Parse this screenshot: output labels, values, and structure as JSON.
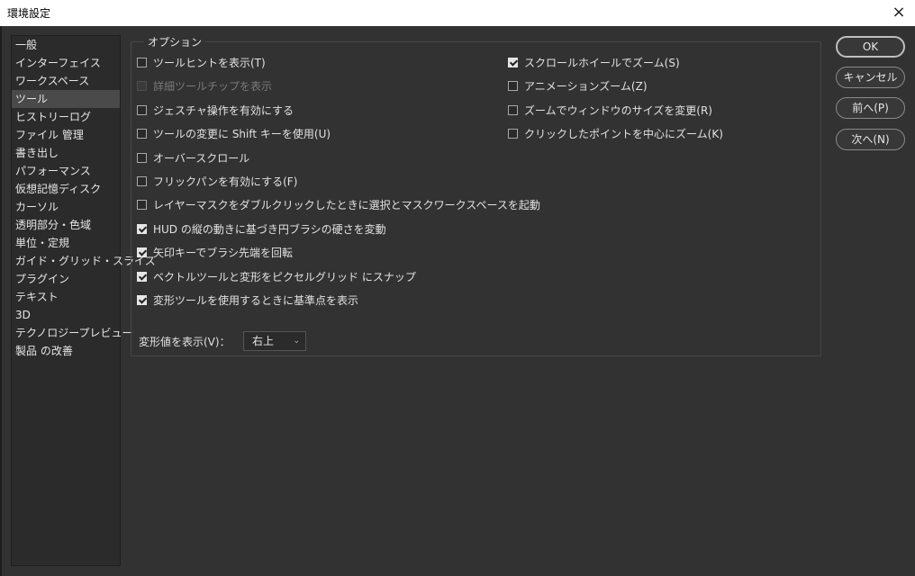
{
  "window": {
    "title": "環境設定",
    "close_icon": "×"
  },
  "sidebar": {
    "items": [
      {
        "label": "一般"
      },
      {
        "label": "インターフェイス"
      },
      {
        "label": "ワークスペース"
      },
      {
        "label": "ツール",
        "selected": true
      },
      {
        "label": "ヒストリーログ"
      },
      {
        "label": "ファイル 管理"
      },
      {
        "label": "書き出し"
      },
      {
        "label": "パフォーマンス"
      },
      {
        "label": "仮想記憶ディスク"
      },
      {
        "label": "カーソル"
      },
      {
        "label": "透明部分・色域"
      },
      {
        "label": "単位・定規"
      },
      {
        "label": "ガイド・グリッド・スライス"
      },
      {
        "label": "プラグイン"
      },
      {
        "label": "テキスト"
      },
      {
        "label": "3D"
      },
      {
        "label": "テクノロジープレビュー"
      },
      {
        "label": "製品 の改善"
      }
    ]
  },
  "options": {
    "title": "オプション",
    "left": [
      {
        "label": "ツールヒントを表示(T)",
        "checked": false
      },
      {
        "label": "詳細ツールチップを表示",
        "checked": false,
        "disabled": true
      },
      {
        "label": "ジェスチャ操作を有効にする",
        "checked": false
      },
      {
        "label": "ツールの変更に Shift キーを使用(U)",
        "checked": false
      },
      {
        "label": "オーバースクロール",
        "checked": false
      },
      {
        "label": "フリックパンを有効にする(F)",
        "checked": false
      },
      {
        "label": "レイヤーマスクをダブルクリックしたときに選択とマスクワークスペースを起動",
        "checked": false
      },
      {
        "label": "HUD の縦の動きに基づき円ブラシの硬さを変動",
        "checked": true
      },
      {
        "label": "矢印キーでブラシ先端を回転",
        "checked": true
      },
      {
        "label": "ベクトルツールと変形をピクセルグリッド にスナップ",
        "checked": true
      },
      {
        "label": "変形ツールを使用するときに基準点を表示",
        "checked": true
      }
    ],
    "right": [
      {
        "label": "スクロールホイールでズーム(S)",
        "checked": true
      },
      {
        "label": "アニメーションズーム(Z)",
        "checked": false
      },
      {
        "label": "ズームでウィンドウのサイズを変更(R)",
        "checked": false
      },
      {
        "label": "クリックしたポイントを中心にズーム(K)",
        "checked": false
      }
    ],
    "transform_label": "変形値を表示(V)：",
    "transform_value": "右上"
  },
  "buttons": {
    "ok": "OK",
    "cancel": "キャンセル",
    "prev": "前へ(P)",
    "next": "次へ(N)"
  }
}
